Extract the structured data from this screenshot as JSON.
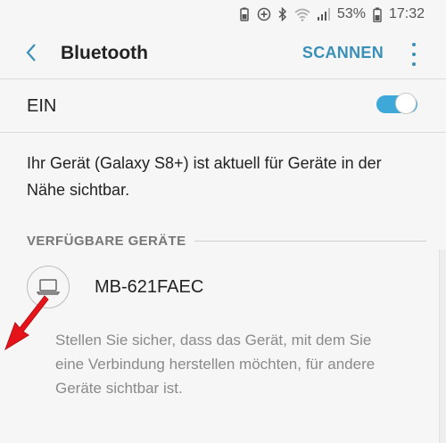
{
  "status_bar": {
    "battery_percent": "53%",
    "time": "17:32",
    "icons": [
      "battery-saver-icon",
      "data-saver-icon",
      "bluetooth-icon",
      "wifi-icon",
      "signal-icon"
    ]
  },
  "header": {
    "title": "Bluetooth",
    "scan_label": "SCANNEN"
  },
  "toggle": {
    "label": "EIN",
    "state": "on",
    "accent_color": "#3ea8d8"
  },
  "visibility_text": "Ihr Gerät (Galaxy S8+) ist aktuell für Geräte in der Nähe sichtbar.",
  "available_devices": {
    "header": "VERFÜGBARE GERÄTE",
    "items": [
      {
        "name": "MB-621FAEC",
        "icon": "laptop-icon"
      }
    ]
  },
  "hint_text": "Stellen Sie sicher, dass das Gerät, mit dem Sie eine Verbindung herstellen möchten, für andere Geräte sichtbar ist.",
  "colors": {
    "accent": "#3a8fb8",
    "arrow": "#e5141b"
  }
}
